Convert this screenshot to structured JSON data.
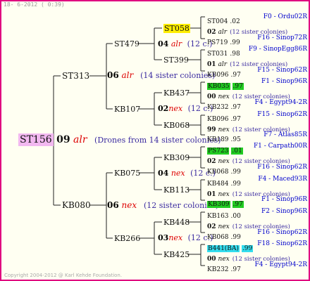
{
  "header": "18- 6-2012 ( 0:39)",
  "copyright": "Copyright 2004-2012 @ Karl Kehde Foundation.",
  "root": {
    "code": "ST156",
    "year": "09",
    "breeder": "alr",
    "note": "(Drones from 14 sister colonies)"
  },
  "sire": {
    "code": "ST313",
    "year": "06",
    "breeder": "alr",
    "note": "(14 sister colonies)"
  },
  "dam": {
    "code": "KB080",
    "year": "06",
    "breeder": "nex",
    "note": "(12 sister colonies)"
  },
  "l2": [
    {
      "code": "ST479",
      "year": "04",
      "breeder": "alr",
      "note": "(12 c.)"
    },
    {
      "code": "KB107",
      "year": "02",
      "breeder": "nex",
      "note": "(12 c.)"
    },
    {
      "code": "KB075",
      "year": "04",
      "breeder": "nex",
      "note": "(12 c.)"
    },
    {
      "code": "KB266",
      "year": "03",
      "breeder": "nex",
      "note": "(12 c.)"
    }
  ],
  "l3": [
    {
      "code": "ST058"
    },
    {
      "code": "ST399"
    },
    {
      "code": "KB437"
    },
    {
      "code": "KB068"
    },
    {
      "code": "KB309"
    },
    {
      "code": "KB113"
    },
    {
      "code": "KB448"
    },
    {
      "code": "KB425"
    }
  ],
  "l4": [
    {
      "code": "ST004",
      "val": ".02",
      "right": "F0 - Ordu02R",
      "hl": ""
    },
    {
      "year": "02",
      "breeder": "alr",
      "note": "(12 sister colonies)"
    },
    {
      "code": "PS719",
      "val": ".99",
      "right": "F16 - Sinop72R",
      "hl": ""
    },
    {
      "code": "ST031",
      "val": ".98",
      "right": "F9 - SinopEgg86R",
      "hl": ""
    },
    {
      "year": "01",
      "breeder": "alr",
      "note": "(12 sister colonies)"
    },
    {
      "code": "KB096",
      "val": ".97",
      "right": "F15 - Sinop62R",
      "hl": ""
    },
    {
      "code": "KB035",
      "val": ".97",
      "right": "F1 - Sinop96R",
      "hl": "green"
    },
    {
      "year": "00",
      "breeder": "nex",
      "note": "(12 sister colonies)"
    },
    {
      "code": "KB232",
      "val": ".97",
      "right": "F4 - Egypt94-2R",
      "hl": ""
    },
    {
      "code": "KB096",
      "val": ".97",
      "right": "F15 - Sinop62R",
      "hl": ""
    },
    {
      "year": "99",
      "breeder": "nex",
      "note": "(12 sister colonies)"
    },
    {
      "code": "KB189",
      "val": ".95",
      "right": "F7 - Atlas85R",
      "hl": ""
    },
    {
      "code": "PS723",
      "val": ".01",
      "right": "F1 - Carpath00R",
      "hl": "green"
    },
    {
      "year": "02",
      "breeder": "nex",
      "note": "(12 sister colonies)"
    },
    {
      "code": "KB068",
      "val": ".99",
      "right": "F16 - Sinop62R",
      "hl": ""
    },
    {
      "code": "KB484",
      "val": ".99",
      "right": "F4 - Maced93R",
      "hl": ""
    },
    {
      "year": "01",
      "breeder": "nex",
      "note": "(12 sister colonies)"
    },
    {
      "code": "KB309",
      "val": ".97",
      "right": "F1 - Sinop96R",
      "hl": "green"
    },
    {
      "code": "KB163",
      "val": ".00",
      "right": "F2 - Sinop96R",
      "hl": ""
    },
    {
      "year": "02",
      "breeder": "nex",
      "note": "(12 sister colonies)"
    },
    {
      "code": "KB068",
      "val": ".99",
      "right": "F16 - Sinop62R",
      "hl": ""
    },
    {
      "code": "B441(BA)",
      "val": ".99",
      "right": "F18 - Sinop62R",
      "hl": "cyan"
    },
    {
      "year": "00",
      "breeder": "nex",
      "note": "(12 sister colonies)"
    },
    {
      "code": "KB232",
      "val": ".97",
      "right": "F4 - Egypt94-2R",
      "hl": ""
    }
  ]
}
